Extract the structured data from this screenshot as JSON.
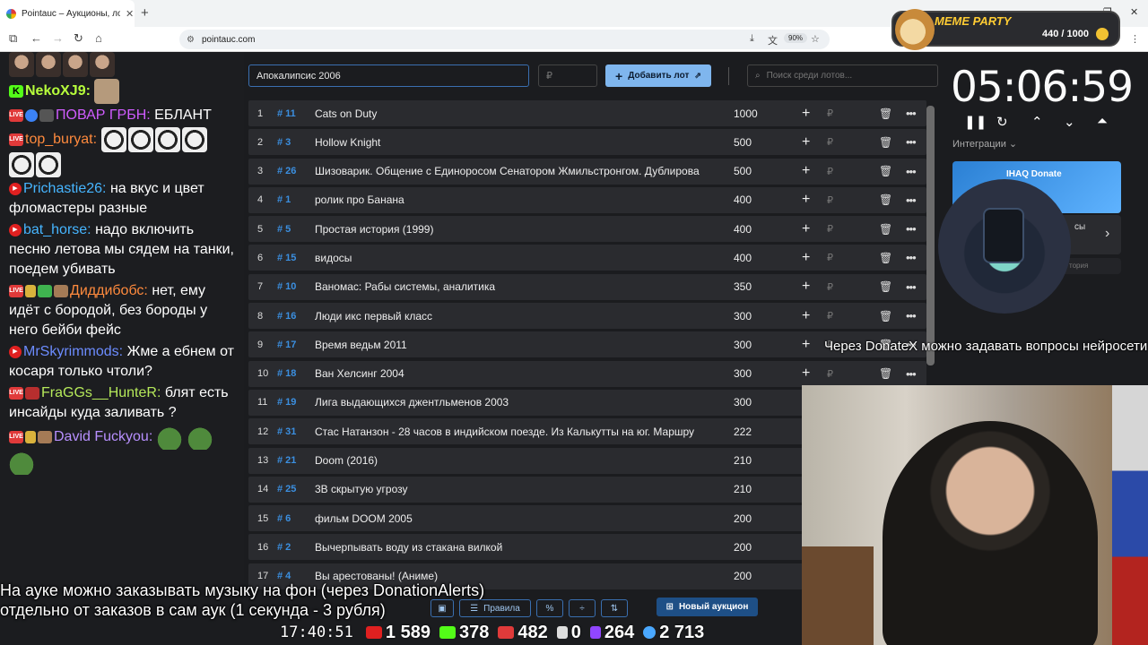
{
  "browser": {
    "tab_title": "Pointauc – Аукционы, лотереи",
    "url": "pointauc.com",
    "zoom": "90%"
  },
  "meme_party": {
    "brand": "MEME PARTY",
    "score": "440 / 1000"
  },
  "chat": [
    {
      "user": "NekoXJ9:",
      "text": ""
    },
    {
      "user": "ПОВАР ГРБН:",
      "text": "ЕБЛАНТ"
    },
    {
      "user": "top_buryat:",
      "text": ""
    },
    {
      "user": "Prichastie26:",
      "text": "на вкус и цвет фломастеры разные"
    },
    {
      "user": "bat_horse:",
      "text": "надо включить песню летова мы сядем на танки, поедем убивать"
    },
    {
      "user": "Диддибобс:",
      "text": "нет, ему идёт с бородой, без бороды у него бейби фейс"
    },
    {
      "user": "MrSkyrimmods:",
      "text": "Жме а ебнем от косаря только чтоли?"
    },
    {
      "user": "FraGGs__HunteR:",
      "text": "блят есть инсайды куда заливать ?"
    },
    {
      "user": "David Fuckyou:",
      "text": ""
    }
  ],
  "auction": {
    "title_value": "Апокалипсис 2006",
    "amount_placeholder": "₽",
    "add_button": "Добавить лот",
    "search_placeholder": "Поиск среди лотов...",
    "currency": "₽",
    "lots": [
      {
        "n": "1",
        "id": "# 11",
        "name": "Cats on Duty",
        "amount": "1000"
      },
      {
        "n": "2",
        "id": "# 3",
        "name": "Hollow Knight",
        "amount": "500"
      },
      {
        "n": "3",
        "id": "# 26",
        "name": "Шизоварик. Общение с Единоросом Сенатором Жмильстронгом. Дублирова",
        "amount": "500"
      },
      {
        "n": "4",
        "id": "# 1",
        "name": "ролик про Банана",
        "amount": "400"
      },
      {
        "n": "5",
        "id": "# 5",
        "name": "Простая история (1999)",
        "amount": "400"
      },
      {
        "n": "6",
        "id": "# 15",
        "name": "видосы",
        "amount": "400"
      },
      {
        "n": "7",
        "id": "# 10",
        "name": "Ваномас: Рабы системы, аналитика",
        "amount": "350"
      },
      {
        "n": "8",
        "id": "# 16",
        "name": "Люди икс первый класс",
        "amount": "300"
      },
      {
        "n": "9",
        "id": "# 17",
        "name": "Время ведьм 2011",
        "amount": "300"
      },
      {
        "n": "10",
        "id": "# 18",
        "name": "Ван Хелсинг 2004",
        "amount": "300"
      },
      {
        "n": "11",
        "id": "# 19",
        "name": "Лига выдающихся джентльменов 2003",
        "amount": "300"
      },
      {
        "n": "12",
        "id": "# 31",
        "name": "Стас Натанзон - 28 часов в индийском поезде. Из Калькутты на юг. Маршру",
        "amount": "222"
      },
      {
        "n": "13",
        "id": "# 21",
        "name": "Doom (2016)",
        "amount": "210"
      },
      {
        "n": "14",
        "id": "# 25",
        "name": "3В скрытую угрозу",
        "amount": "210"
      },
      {
        "n": "15",
        "id": "# 6",
        "name": "фильм DOOM 2005",
        "amount": "200"
      },
      {
        "n": "16",
        "id": "# 2",
        "name": "Вычерпывать воду из стакана вилкой",
        "amount": "200"
      },
      {
        "n": "17",
        "id": "# 4",
        "name": "Вы арестованы! (Аниме)",
        "amount": "200"
      }
    ],
    "rules_button": "Правила",
    "new_auction_button": "Новый аукцион"
  },
  "timer": {
    "value": "05:06:59",
    "integrations": "Интеграции"
  },
  "donate": {
    "title": "IHAQ Donate",
    "card2_text": "сы",
    "card3_text": "тория"
  },
  "overlays": {
    "donatex_note": "Через DonateX можно задавать вопросы нейросети",
    "music_line1": "На ауке можно заказывать музыку на фон (через DonationAlerts)",
    "music_line2": "отдельно от заказов в сам аук (1 секунда - 3 рубля)"
  },
  "stats": {
    "clock": "17:40:51",
    "youtube": "1 589",
    "kick": "378",
    "live": "482",
    "rumble": "0",
    "twitch": "264",
    "total": "2 713"
  },
  "colors": {
    "accent": "#7fb6ee",
    "lot_id": "#3b8fe0",
    "row_bg": "#2a2b2f",
    "page_bg": "#1b1c1f"
  }
}
